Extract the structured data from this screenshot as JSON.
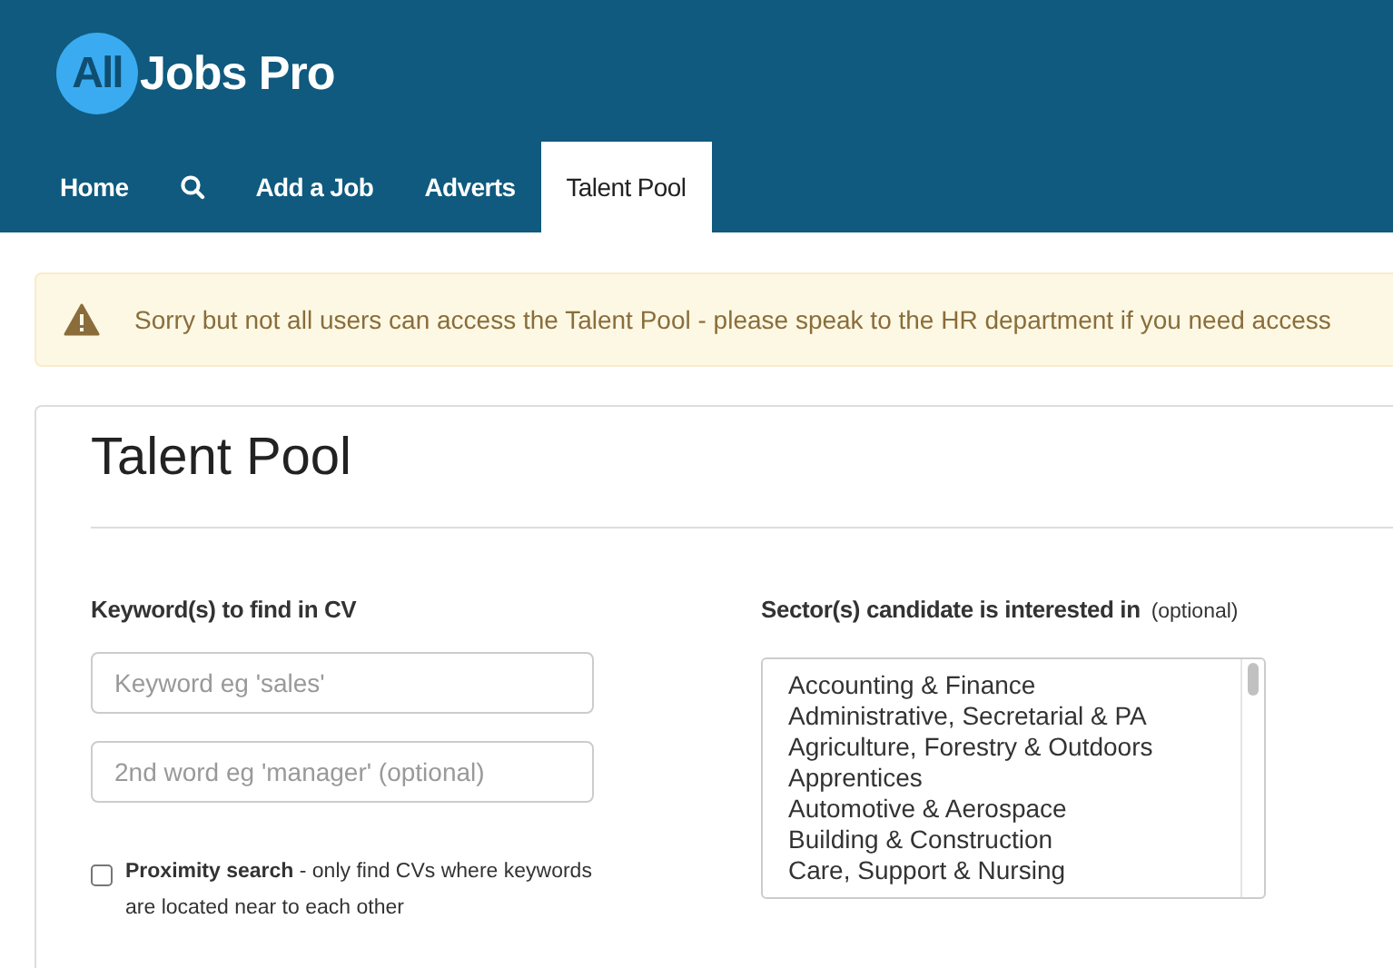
{
  "logo": {
    "badge": "All",
    "text": "Jobs Pro"
  },
  "nav": [
    {
      "kind": "text",
      "label": "Home",
      "selected": false
    },
    {
      "kind": "search",
      "selected": false
    },
    {
      "kind": "text",
      "label": "Add a Job",
      "selected": false
    },
    {
      "kind": "text",
      "label": "Adverts",
      "selected": false
    },
    {
      "kind": "text",
      "label": "Talent Pool",
      "selected": true
    }
  ],
  "alert": {
    "message": "Sorry but not all users can access the Talent Pool - please speak to the HR department if you need access"
  },
  "page": {
    "title": "Talent Pool"
  },
  "keywords": {
    "label": "Keyword(s) to find in CV",
    "fields": [
      {
        "placeholder": "Keyword eg 'sales'"
      },
      {
        "placeholder": "2nd word eg 'manager' (optional)"
      }
    ],
    "proximity": {
      "label": "**Proximity search** - only find CVs where keywords are located near to each other",
      "checked": false
    }
  },
  "sectors": {
    "label": "Sector(s) candidate is interested in",
    "note": "(optional)",
    "options": [
      "Accounting & Finance",
      "Administrative, Secretarial & PA",
      "Agriculture, Forestry & Outdoors",
      "Apprentices",
      "Automotive & Aerospace",
      "Building & Construction",
      "Care, Support & Nursing"
    ]
  }
}
